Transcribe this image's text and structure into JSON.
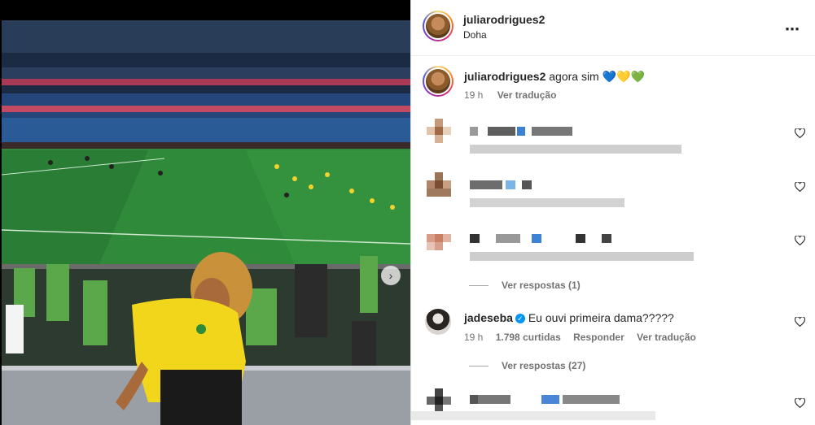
{
  "post": {
    "author": "juliarodrigues2",
    "location": "Doha",
    "more_icon": "⋯"
  },
  "caption": {
    "author": "juliarodrigues2",
    "text": "agora sim 💙💛💚",
    "time": "19 h",
    "translate": "Ver tradução"
  },
  "comments": [
    {
      "blurred": true,
      "replies": null
    },
    {
      "blurred": true,
      "replies": null
    },
    {
      "blurred": true,
      "replies": "Ver respostas (1)"
    },
    {
      "blurred": false,
      "author": "jadeseba",
      "verified_icon": "✓",
      "text": "Eu ouvi primeira dama?????",
      "time": "19 h",
      "likes": "1.798 curtidas",
      "reply": "Responder",
      "translate": "Ver tradução",
      "replies": "Ver respostas (27)"
    },
    {
      "blurred": true,
      "replies": null
    }
  ],
  "carousel": {
    "next_icon": "›"
  },
  "colors": {
    "accent_blue": "#0095f6",
    "muted": "#737373",
    "divider": "#efefef"
  }
}
